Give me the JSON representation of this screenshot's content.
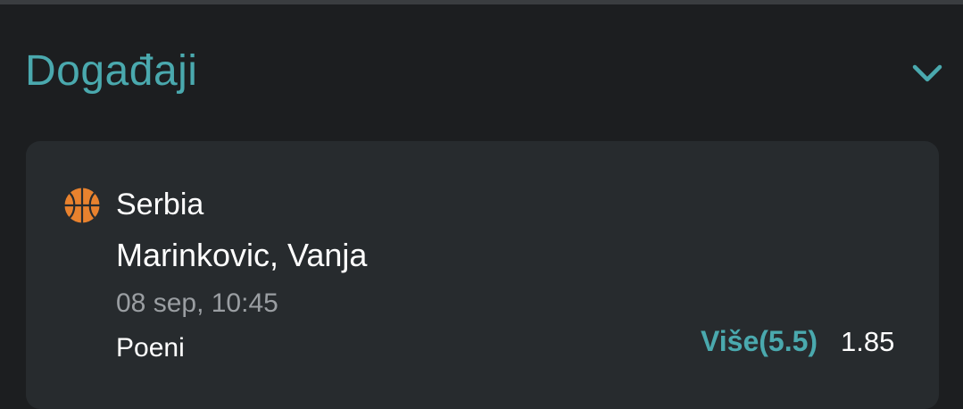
{
  "section": {
    "title": "Događaji",
    "toggle_icon": "chevron-down-icon",
    "accent_color": "#4aa9ae"
  },
  "event": {
    "sport_icon": "basketball-icon",
    "name": "Serbia",
    "player": "Marinkovic, Vanja",
    "datetime": "08 sep, 10:45",
    "market": "Poeni",
    "selection_label": "Više(5.5)",
    "odds": "1.85"
  },
  "colors": {
    "background": "#1c1e20",
    "card": "#272b2e",
    "muted_text": "#9a9ea2",
    "basketball": "#e8822e"
  }
}
